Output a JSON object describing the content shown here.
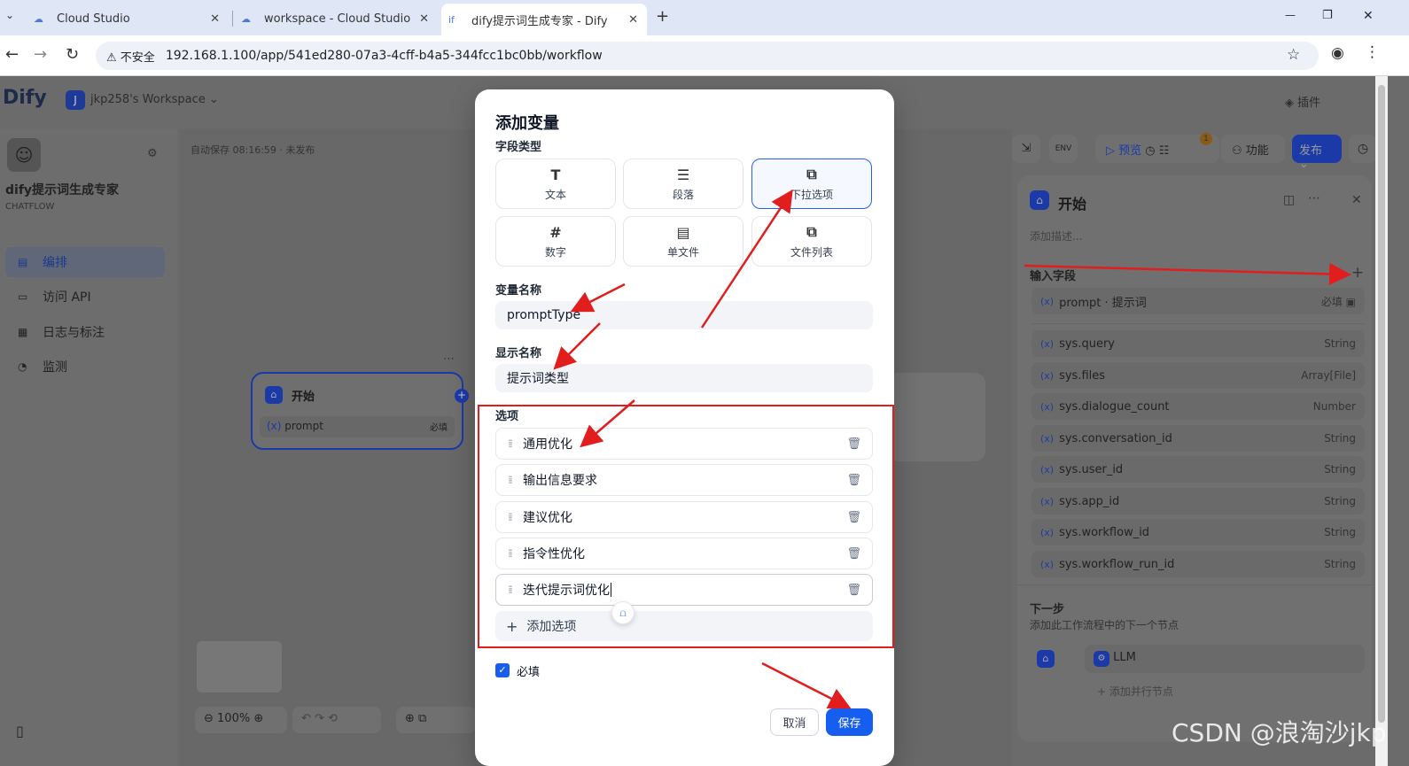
{
  "browser": {
    "tabs": [
      {
        "title": "Cloud Studio"
      },
      {
        "title": "workspace - Cloud Studio"
      },
      {
        "title": "dify提示词生成专家 - Dify"
      }
    ],
    "new_tab": "+",
    "security_label": "不安全",
    "url": "192.168.1.100/app/541ed280-07a3-4cff-b4a5-344fcc1bc0bb/workflow",
    "window_controls": [
      "—",
      "❐",
      "✕"
    ]
  },
  "app": {
    "logo": "Dify",
    "workspace_badge": "J",
    "workspace_name": "jkp258's Workspace",
    "header_right": [
      "插件"
    ],
    "app_name": "dify提示词生成专家",
    "app_type": "CHATFLOW",
    "sidebar_items": [
      {
        "label": "编排",
        "icon": "layout-icon"
      },
      {
        "label": "访问 API",
        "icon": "terminal-icon"
      },
      {
        "label": "日志与标注",
        "icon": "log-icon"
      },
      {
        "label": "监测",
        "icon": "monitor-icon"
      }
    ],
    "autosave": "自动保存 08:16:59 · 未发布",
    "canvas_node": {
      "title": "开始",
      "var": "prompt",
      "required": "必填"
    },
    "zoom": "100%",
    "toolbar": {
      "preview": "预览",
      "features": "功能",
      "publish": "发布",
      "badge_count": "1"
    },
    "panel": {
      "title": "开始",
      "desc_placeholder": "添加描述...",
      "input_fields_label": "输入字段",
      "prompt_var": {
        "name": "prompt · 提示词",
        "required": "必填"
      },
      "sys_vars": [
        {
          "name": "sys.query",
          "type": "String"
        },
        {
          "name": "sys.files",
          "type": "Array[File]"
        },
        {
          "name": "sys.dialogue_count",
          "type": "Number"
        },
        {
          "name": "sys.conversation_id",
          "type": "String"
        },
        {
          "name": "sys.user_id",
          "type": "String"
        },
        {
          "name": "sys.app_id",
          "type": "String"
        },
        {
          "name": "sys.workflow_id",
          "type": "String"
        },
        {
          "name": "sys.workflow_run_id",
          "type": "String"
        }
      ],
      "next_step_title": "下一步",
      "next_step_desc": "添加此工作流程中的下一个节点",
      "next_node": "LLM",
      "add_parallel": "添加并行节点"
    }
  },
  "modal": {
    "title": "添加变量",
    "field_type_label": "字段类型",
    "field_types": [
      {
        "label": "文本",
        "icon": "T"
      },
      {
        "label": "段落",
        "icon": "☰"
      },
      {
        "label": "下拉选项",
        "icon": "⧉"
      },
      {
        "label": "数字",
        "icon": "#"
      },
      {
        "label": "单文件",
        "icon": "▤"
      },
      {
        "label": "文件列表",
        "icon": "⧉"
      }
    ],
    "selected_type": "下拉选项",
    "var_name_label": "变量名称",
    "var_name_value": "promptType",
    "display_name_label": "显示名称",
    "display_name_value": "提示词类型",
    "options_label": "选项",
    "options": [
      "通用优化",
      "输出信息要求",
      "建议优化",
      "指令性优化",
      "迭代提示词优化"
    ],
    "add_option": "添加选项",
    "required_label": "必填",
    "required_checked": true,
    "cancel": "取消",
    "save": "保存",
    "accent_color": "#155eef",
    "highlight_color": "#e11d1d"
  },
  "watermark": "CSDN @浪淘沙jkp"
}
